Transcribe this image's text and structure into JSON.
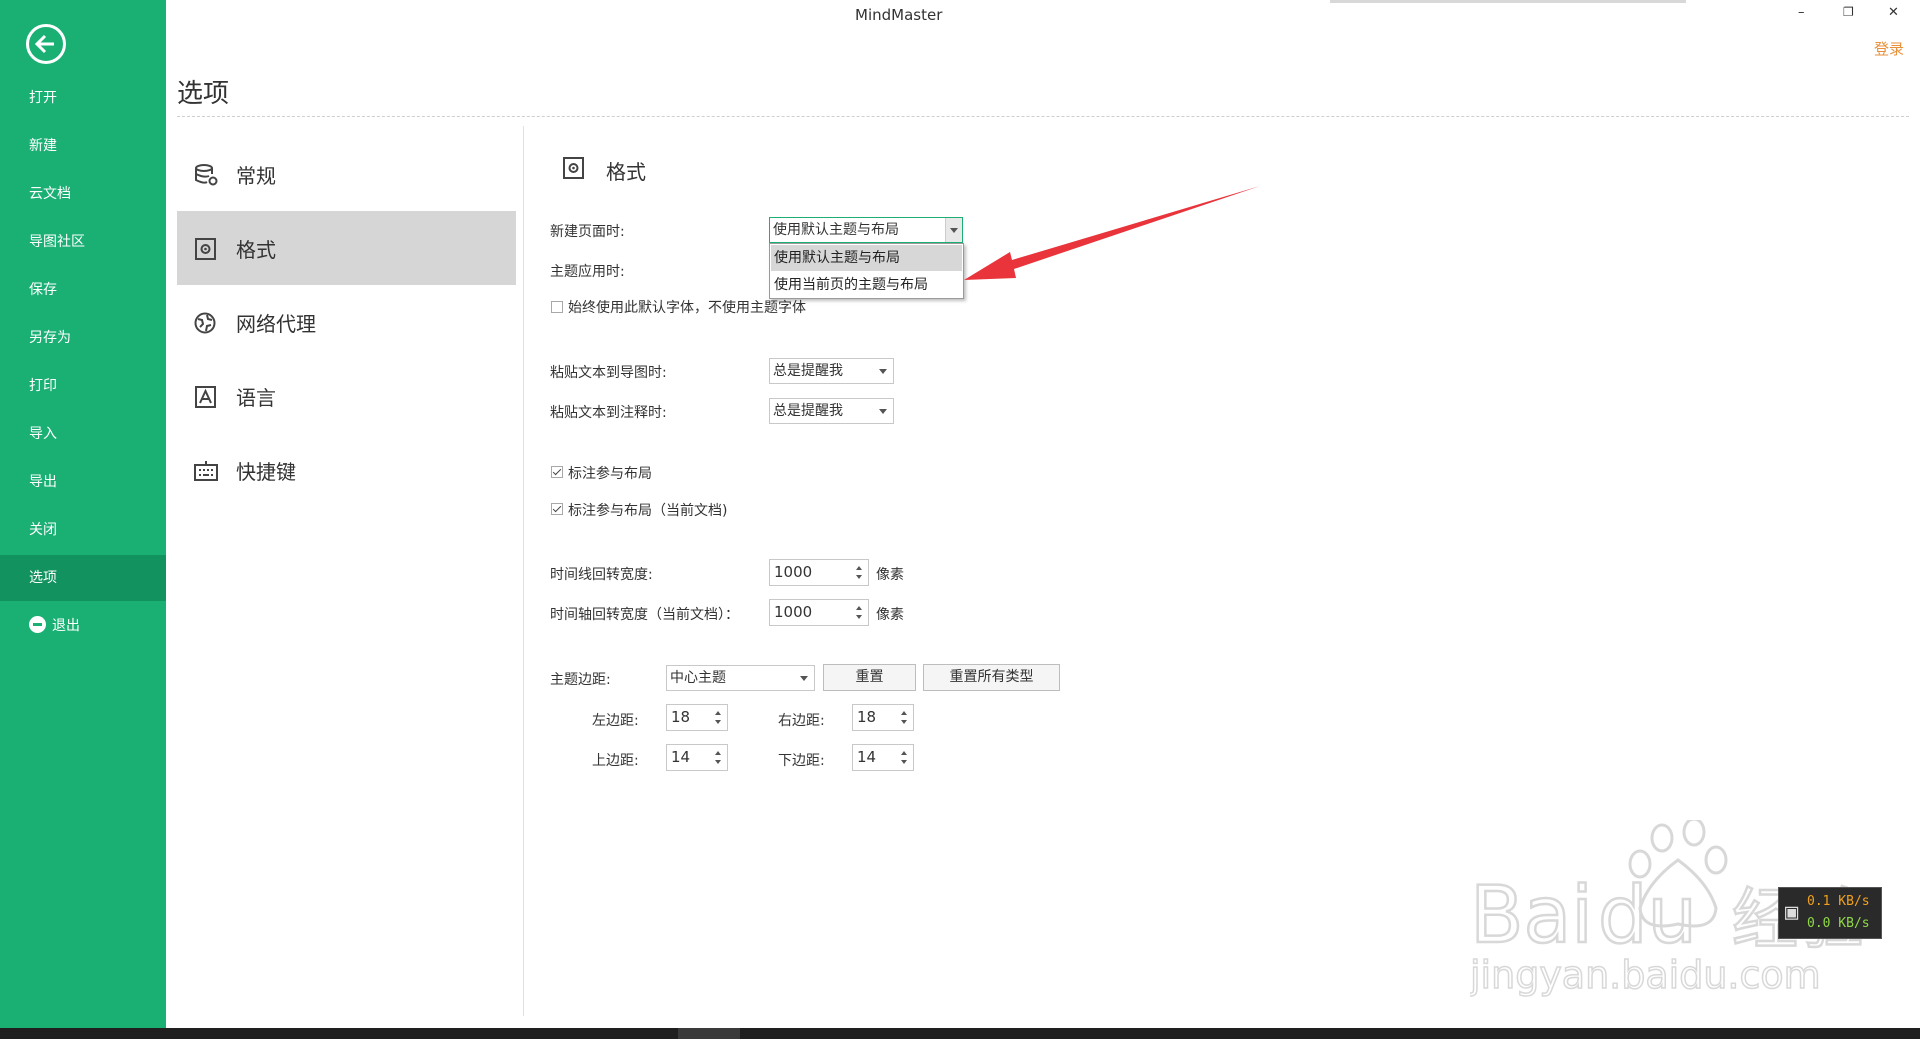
{
  "app": {
    "title": "MindMaster",
    "login": "登录"
  },
  "window_controls": {
    "minimize": "–",
    "restore": "❐",
    "close": "✕"
  },
  "sidebar": {
    "back_icon": "back-arrow-icon",
    "items": [
      {
        "label": "打开"
      },
      {
        "label": "新建"
      },
      {
        "label": "云文档"
      },
      {
        "label": "导图社区"
      },
      {
        "label": "保存"
      },
      {
        "label": "另存为"
      },
      {
        "label": "打印"
      },
      {
        "label": "导入"
      },
      {
        "label": "导出"
      },
      {
        "label": "关闭"
      },
      {
        "label": "选项",
        "active": true
      },
      {
        "label": "退出"
      }
    ]
  },
  "page": {
    "title": "选项"
  },
  "options_nav": [
    {
      "label": "常规",
      "icon": "general-settings-icon"
    },
    {
      "label": "格式",
      "icon": "format-icon",
      "active": true
    },
    {
      "label": "网络代理",
      "icon": "proxy-globe-icon"
    },
    {
      "label": "语言",
      "icon": "language-icon"
    },
    {
      "label": "快捷键",
      "icon": "keyboard-icon"
    }
  ],
  "format": {
    "section_title": "格式",
    "new_page_label": "新建页面时:",
    "new_page_value": "使用默认主题与布局",
    "new_page_options": [
      "使用默认主题与布局",
      "使用当前页的主题与布局"
    ],
    "theme_apply_label": "主题应用时:",
    "always_default_font": {
      "label": "始终使用此默认字体，不使用主题字体",
      "checked": false
    },
    "paste_map_label": "粘贴文本到导图时:",
    "paste_map_value": "总是提醒我",
    "paste_note_label": "粘贴文本到注释时:",
    "paste_note_value": "总是提醒我",
    "callout_layout": {
      "label": "标注参与布局",
      "checked": true
    },
    "callout_layout_doc": {
      "label": "标注参与布局（当前文档)",
      "checked": true
    },
    "timeline_wrap_label": "时间线回转宽度:",
    "timeline_wrap_value": "1000",
    "timeline_axis_label": "时间轴回转宽度（当前文档）：",
    "timeline_axis_value": "1000",
    "unit_pixels": "像素",
    "topic_margin_label": "主题边距:",
    "topic_margin_type": "中心主题",
    "reset_label": "重置",
    "reset_all_label": "重置所有类型",
    "left_label": "左边距:",
    "left_value": "18",
    "right_label": "右边距:",
    "right_value": "18",
    "top_label": "上边距:",
    "top_value": "14",
    "bottom_label": "下边距:",
    "bottom_value": "14"
  },
  "net_monitor": {
    "up": "0.1 KB/s",
    "down": "0.0 KB/s"
  },
  "watermark": {
    "brand": "Bai",
    "brand2": "du",
    "brand3": "经验",
    "url": "jingyan.baidu.com"
  },
  "colors": {
    "sidebar_bg": "#1ab074",
    "sidebar_active": "#12925f",
    "login": "#e8913a",
    "annotation": "#e8343a"
  }
}
